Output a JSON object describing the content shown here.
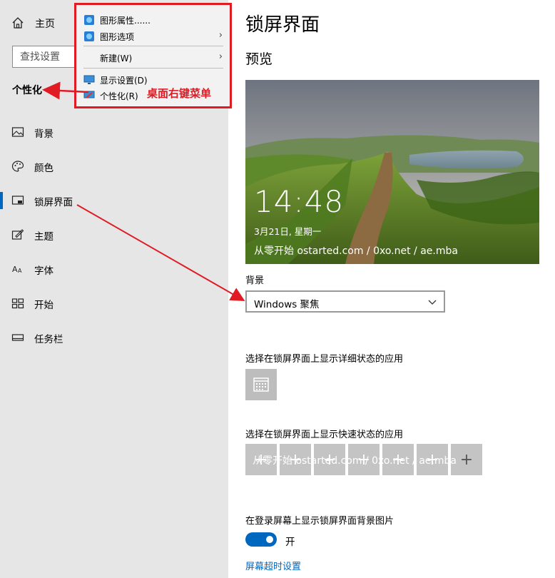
{
  "sidebar": {
    "home_label": "主页",
    "search_placeholder": "查找设置",
    "section_title": "个性化",
    "items": [
      {
        "label": "背景",
        "icon": "image-icon"
      },
      {
        "label": "颜色",
        "icon": "palette-icon"
      },
      {
        "label": "锁屏界面",
        "icon": "lock-screen-icon",
        "selected": true
      },
      {
        "label": "主题",
        "icon": "theme-icon"
      },
      {
        "label": "字体",
        "icon": "font-icon"
      },
      {
        "label": "开始",
        "icon": "start-icon"
      },
      {
        "label": "任务栏",
        "icon": "taskbar-icon"
      }
    ]
  },
  "context_menu": {
    "items": [
      {
        "label": "图形属性......",
        "icon": "graphics-icon"
      },
      {
        "label": "图形选项",
        "icon": "graphics-icon",
        "submenu": true
      },
      {
        "label": "新建(W)",
        "submenu": true
      },
      {
        "label": "显示设置(D)",
        "icon": "display-icon"
      },
      {
        "label": "个性化(R)",
        "icon": "personalize-icon"
      }
    ],
    "callout": "桌面右键菜单",
    "highlight_color": "#e01b24"
  },
  "main": {
    "title": "锁屏界面",
    "preview_heading": "预览",
    "preview": {
      "time": "14:48",
      "date": "3月21日, 星期一",
      "watermark": "从零开始 ostarted.com / 0xo.net / ae.mba"
    },
    "background_label": "背景",
    "background_value": "Windows 聚焦",
    "detail_status_label": "选择在锁屏界面上显示详细状态的应用",
    "quick_status_label": "选择在锁屏界面上显示快速状态的应用",
    "quick_add_symbol": "+",
    "login_bg_label": "在登录屏幕上显示锁屏界面背景图片",
    "toggle_state": "开",
    "screen_timeout_link": "屏幕超时设置",
    "accent_color": "#0067c0"
  }
}
